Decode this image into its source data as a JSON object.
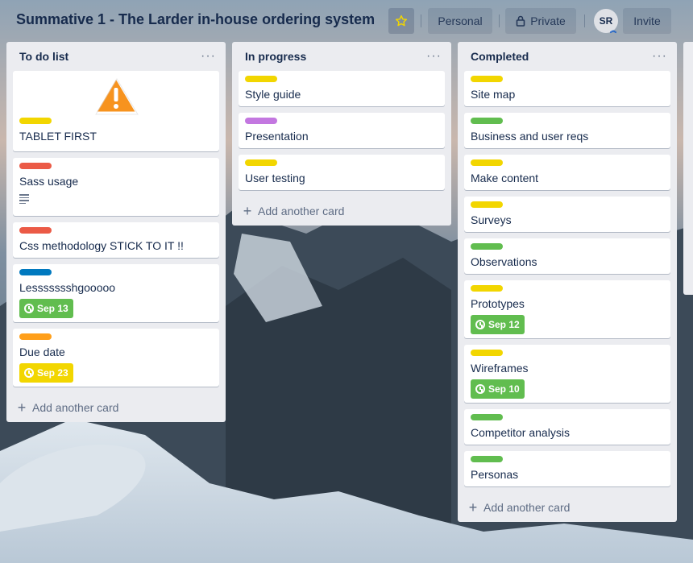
{
  "board": {
    "title": "Summative 1 - The Larder in-house ordering system",
    "personal_label": "Personal",
    "private_label": "Private",
    "avatar_initials": "SR",
    "invite_label": "Invite"
  },
  "colors": {
    "yellow": "#f2d600",
    "red": "#eb5a46",
    "blue": "#0079bf",
    "orange": "#ff9f1a",
    "purple": "#c377e0",
    "green": "#61bd4f",
    "due_green": "#61bd4f",
    "due_yellow": "#f2d600"
  },
  "lists": [
    {
      "title": "To do list",
      "menu": "···",
      "add_label": "Add another card",
      "cards": [
        {
          "title": "TABLET FIRST",
          "label": "yellow",
          "image": "warning-sign-icon"
        },
        {
          "title": "Sass usage",
          "label": "red",
          "has_description": true
        },
        {
          "title": "Css methodology STICK TO IT !!",
          "label": "red"
        },
        {
          "title": "Lessssssshgooooo",
          "label": "blue",
          "due": "Sep 13",
          "due_color": "green"
        },
        {
          "title": "Due date",
          "label": "orange",
          "due": "Sep 23",
          "due_color": "yellow"
        }
      ]
    },
    {
      "title": "In progress",
      "menu": "···",
      "add_label": "Add another card",
      "cards": [
        {
          "title": "Style guide",
          "label": "yellow"
        },
        {
          "title": "Presentation",
          "label": "purple"
        },
        {
          "title": "User testing",
          "label": "yellow"
        }
      ]
    },
    {
      "title": "Completed",
      "menu": "···",
      "add_label": "Add another card",
      "cards": [
        {
          "title": "Site map",
          "label": "yellow"
        },
        {
          "title": "Business and user reqs",
          "label": "green"
        },
        {
          "title": "Make content",
          "label": "yellow"
        },
        {
          "title": "Surveys",
          "label": "yellow"
        },
        {
          "title": "Observations",
          "label": "green"
        },
        {
          "title": "Prototypes",
          "label": "yellow",
          "due": "Sep 12",
          "due_color": "green"
        },
        {
          "title": "Wireframes",
          "label": "yellow",
          "due": "Sep 10",
          "due_color": "green"
        },
        {
          "title": "Competitor analysis",
          "label": "green"
        },
        {
          "title": "Personas",
          "label": "green"
        }
      ]
    }
  ]
}
